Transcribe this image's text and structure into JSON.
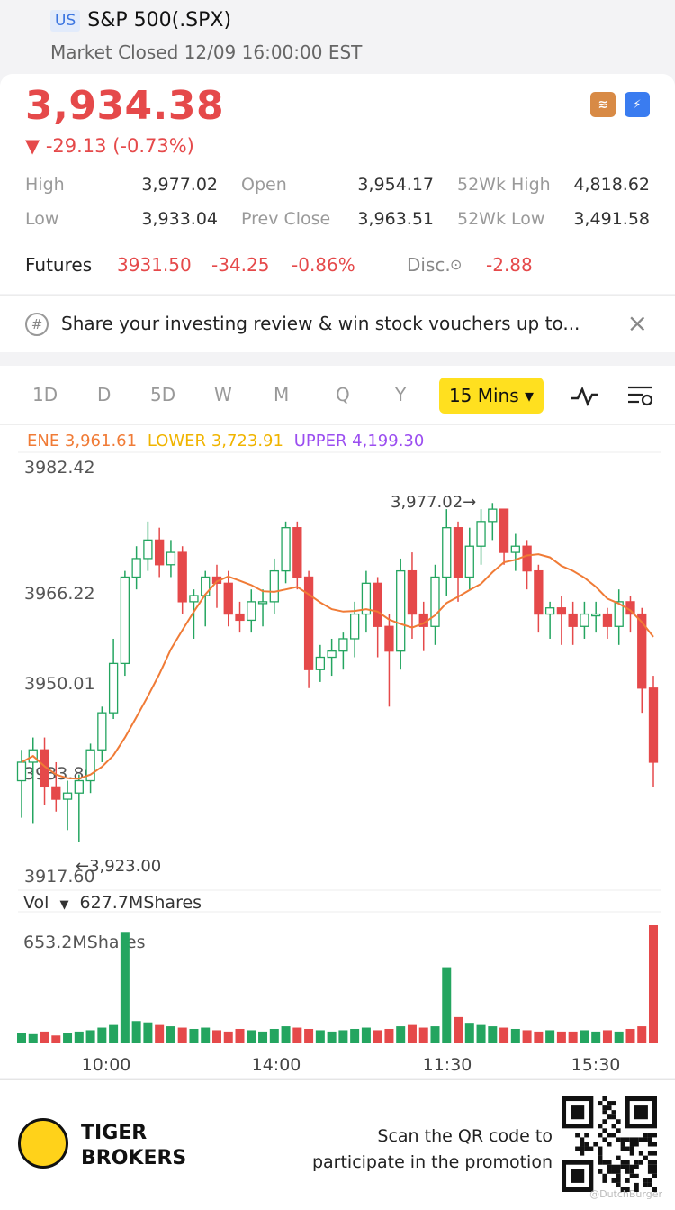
{
  "header": {
    "market_badge": "US",
    "title": "S&P 500(.SPX)",
    "status": "Market Closed 12/09 16:00:00 EST"
  },
  "quote": {
    "price": "3,934.38",
    "change": "▼ -29.13 (-0.73%)",
    "stats": [
      {
        "label": "High",
        "value": "3,977.02"
      },
      {
        "label": "Open",
        "value": "3,954.17"
      },
      {
        "label": "52Wk High",
        "value": "4,818.62"
      },
      {
        "label": "Low",
        "value": "3,933.04"
      },
      {
        "label": "Prev Close",
        "value": "3,963.51"
      },
      {
        "label": "52Wk Low",
        "value": "3,491.58"
      }
    ],
    "futures": {
      "label": "Futures",
      "price": "3931.50",
      "change": "-34.25",
      "change_pct": "-0.86%",
      "disc_label": "Disc.",
      "disc_value": "-2.88"
    }
  },
  "promo": {
    "text": "Share your investing review & win stock vouchers up to..."
  },
  "tabs": {
    "items": [
      "1D",
      "D",
      "5D",
      "W",
      "M",
      "Q",
      "Y"
    ],
    "active": "15 Mins ▾"
  },
  "indicator": {
    "ene": "ENE 3,961.61",
    "lower": "LOWER 3,723.91",
    "upper": "UPPER 4,199.30"
  },
  "chart": {
    "y_labels": [
      "3982.42",
      "3966.22",
      "3950.01",
      "3933.80",
      "3917.60"
    ],
    "high_marker": "3,977.02",
    "low_marker": "3,923.00",
    "x_labels": [
      "10:00",
      "14:00",
      "11:30",
      "15:30"
    ],
    "volume_label": "Vol",
    "volume_value": "627.7MShares",
    "volume_max": "653.2MShares",
    "colors": {
      "up": "#24a560",
      "down": "#e5494a",
      "ene": "#f07b36"
    }
  },
  "chart_data": {
    "type": "candlestick",
    "ylim": [
      3917.6,
      3982.42
    ],
    "candles": [
      [
        3933,
        3936,
        3927,
        3938
      ],
      [
        3936,
        3938,
        3926,
        3940
      ],
      [
        3938,
        3932,
        3929,
        3940
      ],
      [
        3932,
        3930,
        3928,
        3936
      ],
      [
        3930,
        3931,
        3925,
        3933
      ],
      [
        3931,
        3933,
        3923,
        3934
      ],
      [
        3933,
        3938,
        3931,
        3939
      ],
      [
        3938,
        3944,
        3936,
        3945
      ],
      [
        3944,
        3952,
        3943,
        3956
      ],
      [
        3952,
        3966,
        3950,
        3967
      ],
      [
        3966,
        3969,
        3964,
        3971
      ],
      [
        3969,
        3972,
        3967,
        3975
      ],
      [
        3972,
        3968,
        3966,
        3974
      ],
      [
        3968,
        3970,
        3966,
        3972
      ],
      [
        3970,
        3962,
        3960,
        3971
      ],
      [
        3962,
        3963,
        3956,
        3964
      ],
      [
        3963,
        3966,
        3958,
        3967
      ],
      [
        3966,
        3965,
        3961,
        3968
      ],
      [
        3965,
        3960,
        3958,
        3967
      ],
      [
        3960,
        3959,
        3957,
        3962
      ],
      [
        3959,
        3962,
        3957,
        3964
      ],
      [
        3962,
        3962,
        3958,
        3964
      ],
      [
        3962,
        3967,
        3960,
        3969
      ],
      [
        3967,
        3974,
        3965,
        3975
      ],
      [
        3974,
        3966,
        3964,
        3975
      ],
      [
        3966,
        3951,
        3948,
        3967
      ],
      [
        3951,
        3953,
        3949,
        3955
      ],
      [
        3953,
        3954,
        3950,
        3956
      ],
      [
        3954,
        3956,
        3951,
        3957
      ],
      [
        3956,
        3960,
        3953,
        3962
      ],
      [
        3960,
        3965,
        3957,
        3967
      ],
      [
        3965,
        3958,
        3953,
        3966
      ],
      [
        3958,
        3954,
        3945,
        3960
      ],
      [
        3954,
        3967,
        3951,
        3969
      ],
      [
        3967,
        3960,
        3956,
        3970
      ],
      [
        3960,
        3958,
        3954,
        3962
      ],
      [
        3958,
        3966,
        3955,
        3968
      ],
      [
        3966,
        3974,
        3963,
        3977
      ],
      [
        3974,
        3966,
        3962,
        3975
      ],
      [
        3966,
        3971,
        3964,
        3974
      ],
      [
        3971,
        3975,
        3968,
        3977
      ],
      [
        3975,
        3977,
        3972,
        3978
      ],
      [
        3977,
        3970,
        3968,
        3977
      ],
      [
        3970,
        3971,
        3967,
        3973
      ],
      [
        3971,
        3967,
        3964,
        3972
      ],
      [
        3967,
        3960,
        3957,
        3968
      ],
      [
        3960,
        3961,
        3956,
        3962
      ],
      [
        3961,
        3960,
        3955,
        3963
      ],
      [
        3960,
        3958,
        3955,
        3962
      ],
      [
        3958,
        3960,
        3956,
        3962
      ],
      [
        3960,
        3960,
        3957,
        3962
      ],
      [
        3960,
        3958,
        3956,
        3961
      ],
      [
        3958,
        3962,
        3955,
        3964
      ],
      [
        3962,
        3960,
        3957,
        3963
      ],
      [
        3960,
        3948,
        3944,
        3961
      ],
      [
        3948,
        3936,
        3932,
        3950
      ]
    ],
    "volume": [
      8,
      7,
      9,
      6,
      8,
      9,
      10,
      12,
      14,
      85,
      17,
      16,
      14,
      13,
      12,
      11,
      12,
      10,
      9,
      11,
      10,
      9,
      11,
      13,
      12,
      11,
      10,
      9,
      10,
      11,
      12,
      10,
      11,
      13,
      14,
      12,
      13,
      58,
      20,
      15,
      14,
      13,
      12,
      11,
      10,
      9,
      10,
      9,
      9,
      10,
      9,
      10,
      9,
      11,
      13,
      90
    ]
  },
  "footer": {
    "brand_line1": "TIGER",
    "brand_line2": "BROKERS",
    "scan_line1": "Scan the QR code to",
    "scan_line2": "participate in the promotion",
    "watermark": "@DutchBurger"
  }
}
